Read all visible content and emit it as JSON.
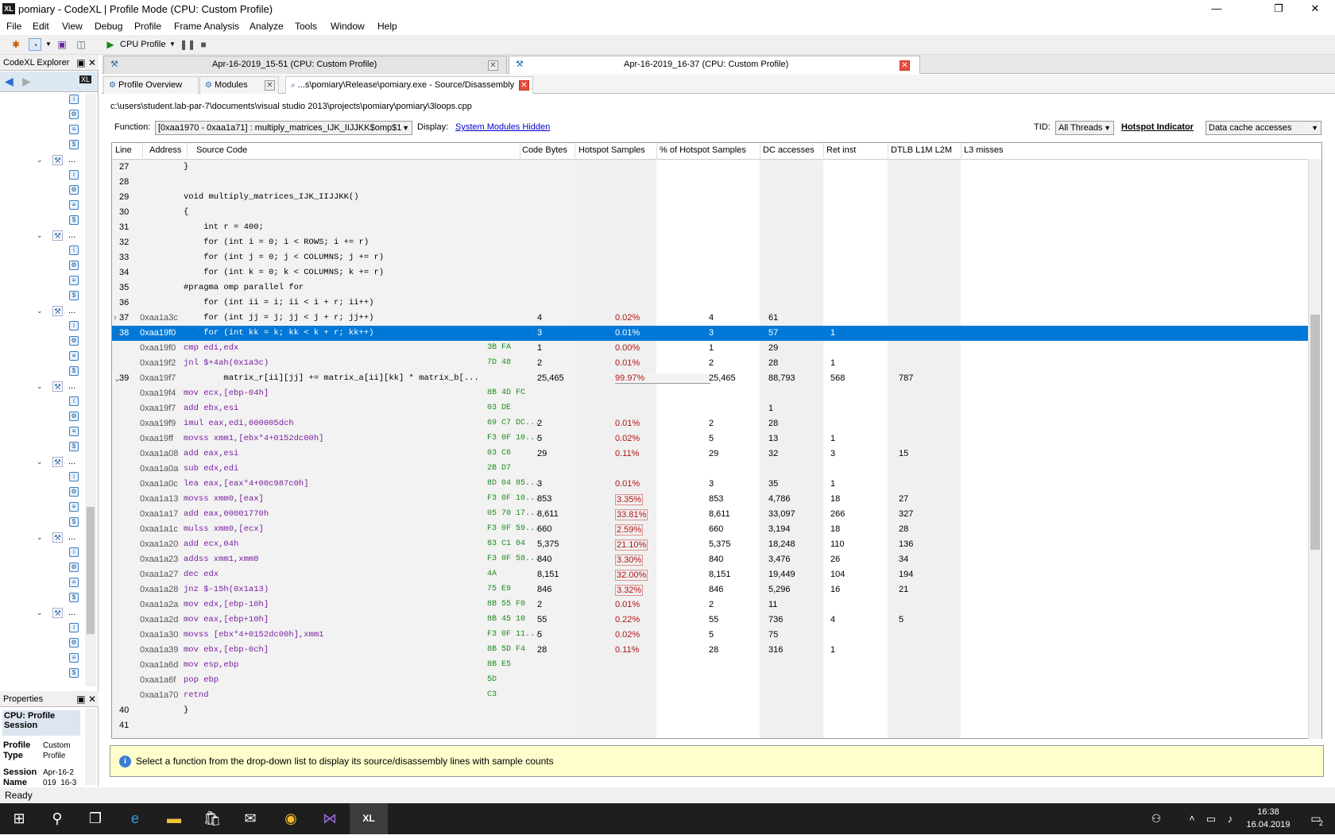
{
  "window": {
    "title": "pomiary - CodeXL | Profile Mode (CPU: Custom Profile)",
    "logo": "XL",
    "minimize": "—",
    "maximize": "❐",
    "close": "✕"
  },
  "menu": [
    "File",
    "Edit",
    "View",
    "Debug",
    "Profile",
    "Frame Analysis",
    "Analyze",
    "Tools",
    "Window",
    "Help"
  ],
  "toolbar": {
    "mode_label": "CPU Profile"
  },
  "explorer": {
    "title": "CodeXL Explorer",
    "dots": "..."
  },
  "properties": {
    "title": "Properties",
    "heading": "CPU: Profile Session",
    "rows": [
      {
        "k": "Profile Type",
        "v": "Custom Profile"
      },
      {
        "k": "Session Name",
        "v": "Apr-16-2 019_16-3"
      }
    ]
  },
  "session_tabs": [
    {
      "label": "Apr-16-2019_15-51 (CPU: Custom Profile)"
    },
    {
      "label": "Apr-16-2019_16-37 (CPU: Custom Profile)"
    }
  ],
  "sub_tabs": [
    {
      "label": "Profile Overview"
    },
    {
      "label": "Modules"
    },
    {
      "label": "...s\\pomiary\\Release\\pomiary.exe - Source/Disassembly"
    }
  ],
  "file_path": "c:\\users\\student.lab-par-7\\documents\\visual studio 2013\\projects\\pomiary\\pomiary\\3loops.cpp",
  "filter": {
    "function_label": "Function:",
    "function_value": "[0xaa1970 - 0xaa1a71] : multiply_matrices_IJK_IIJJKK$omp$1",
    "display_label": "Display:",
    "display_link": "System Modules Hidden",
    "tid_label": "TID:",
    "tid_value": "All Threads",
    "hotspot_label": "Hotspot Indicator",
    "hotspot_value": "Data cache accesses"
  },
  "columns": [
    "Line",
    "Address",
    "Source Code",
    "Code Bytes",
    "Hotspot Samples",
    "% of Hotspot Samples",
    "DC accesses",
    "Ret inst",
    "DTLB L1M L2M",
    "L3 misses"
  ],
  "rows": [
    {
      "line": "27",
      "exp": "",
      "addr": "",
      "code": "}",
      "type": "src",
      "bytes": "",
      "hs": "",
      "pct": "",
      "dc": "",
      "ret": "",
      "dtlb": "",
      "l3": ""
    },
    {
      "line": "28",
      "exp": "",
      "addr": "",
      "code": "",
      "type": "src",
      "bytes": "",
      "hs": "",
      "pct": "",
      "dc": "",
      "ret": "",
      "dtlb": "",
      "l3": ""
    },
    {
      "line": "29",
      "exp": "",
      "addr": "",
      "code": "void multiply_matrices_IJK_IIJJKK()",
      "type": "src",
      "bytes": "",
      "hs": "",
      "pct": "",
      "dc": "",
      "ret": "",
      "dtlb": "",
      "l3": ""
    },
    {
      "line": "30",
      "exp": "",
      "addr": "",
      "code": "{",
      "type": "src",
      "bytes": "",
      "hs": "",
      "pct": "",
      "dc": "",
      "ret": "",
      "dtlb": "",
      "l3": ""
    },
    {
      "line": "31",
      "exp": "",
      "addr": "",
      "code": "    int r = 400;",
      "type": "src",
      "bytes": "",
      "hs": "",
      "pct": "",
      "dc": "",
      "ret": "",
      "dtlb": "",
      "l3": ""
    },
    {
      "line": "32",
      "exp": "",
      "addr": "",
      "code": "    for (int i = 0; i < ROWS; i += r)",
      "type": "src",
      "bytes": "",
      "hs": "",
      "pct": "",
      "dc": "",
      "ret": "",
      "dtlb": "",
      "l3": ""
    },
    {
      "line": "33",
      "exp": "",
      "addr": "",
      "code": "    for (int j = 0; j < COLUMNS; j += r)",
      "type": "src",
      "bytes": "",
      "hs": "",
      "pct": "",
      "dc": "",
      "ret": "",
      "dtlb": "",
      "l3": ""
    },
    {
      "line": "34",
      "exp": "",
      "addr": "",
      "code": "    for (int k = 0; k < COLUMNS; k += r)",
      "type": "src",
      "bytes": "",
      "hs": "",
      "pct": "",
      "dc": "",
      "ret": "",
      "dtlb": "",
      "l3": ""
    },
    {
      "line": "35",
      "exp": "",
      "addr": "",
      "code": "#pragma omp parallel for",
      "type": "src",
      "bytes": "",
      "hs": "",
      "pct": "",
      "dc": "",
      "ret": "",
      "dtlb": "",
      "l3": ""
    },
    {
      "line": "36",
      "exp": "",
      "addr": "",
      "code": "    for (int ii = i; ii < i + r; ii++)",
      "type": "src",
      "bytes": "",
      "hs": "",
      "pct": "",
      "dc": "",
      "ret": "",
      "dtlb": "",
      "l3": ""
    },
    {
      "line": "37",
      "exp": "›",
      "addr": "0xaa1a3c",
      "code": "    for (int jj = j; jj < j + r; jj++)",
      "type": "src",
      "bytes": "",
      "hs": "4",
      "pct": "0.02%",
      "dc": "4",
      "ret": "61",
      "dtlb": "",
      "l3": ""
    },
    {
      "line": "38",
      "exp": "⌄",
      "addr": "0xaa19f0",
      "code": "    for (int kk = k; kk < k + r; kk++)",
      "type": "sel",
      "bytes": "",
      "hs": "3",
      "pct": "0.01%",
      "dc": "3",
      "ret": "57",
      "dtlb": "1",
      "l3": ""
    },
    {
      "line": "",
      "exp": "",
      "addr": "0xaa19f0",
      "code": "cmp edi,edx",
      "type": "asm",
      "bytes": "3B FA",
      "hs": "1",
      "pct": "0.00%",
      "dc": "1",
      "ret": "29",
      "dtlb": "",
      "l3": ""
    },
    {
      "line": "",
      "exp": "",
      "addr": "0xaa19f2",
      "code": "jnl $+4ah(0x1a3c)",
      "type": "asm",
      "bytes": "7D 48",
      "hs": "2",
      "pct": "0.01%",
      "dc": "2",
      "ret": "28",
      "dtlb": "1",
      "l3": ""
    },
    {
      "line": "39",
      "exp": "⌄",
      "addr": "0xaa19f7",
      "code": "        matrix_r[ii][jj] += matrix_a[ii][kk] * matrix_b[...",
      "type": "src",
      "bytes": "",
      "hs": "25,465",
      "pct": "99.97%",
      "dc": "25,465",
      "ret": "88,793",
      "dtlb": "568",
      "l3": "787",
      "bigbar": true
    },
    {
      "line": "",
      "exp": "",
      "addr": "0xaa19f4",
      "code": "mov ecx,[ebp-04h]",
      "type": "asm",
      "bytes": "8B 4D FC",
      "hs": "",
      "pct": "",
      "dc": "",
      "ret": "",
      "dtlb": "",
      "l3": ""
    },
    {
      "line": "",
      "exp": "",
      "addr": "0xaa19f7",
      "code": "add ebx,esi",
      "type": "asm",
      "bytes": "03 DE",
      "hs": "",
      "pct": "",
      "dc": "",
      "ret": "1",
      "dtlb": "",
      "l3": ""
    },
    {
      "line": "",
      "exp": "",
      "addr": "0xaa19f9",
      "code": "imul eax,edi,000005dch",
      "type": "asm",
      "bytes": "69 C7 DC...",
      "hs": "2",
      "pct": "0.01%",
      "dc": "2",
      "ret": "28",
      "dtlb": "",
      "l3": ""
    },
    {
      "line": "",
      "exp": "",
      "addr": "0xaa19ff",
      "code": "movss xmm1,[ebx*4+0152dc00h]",
      "type": "asm",
      "bytes": "F3 0F 10...",
      "hs": "5",
      "pct": "0.02%",
      "dc": "5",
      "ret": "13",
      "dtlb": "1",
      "l3": ""
    },
    {
      "line": "",
      "exp": "",
      "addr": "0xaa1a08",
      "code": "add eax,esi",
      "type": "asm",
      "bytes": "03 C6",
      "hs": "29",
      "pct": "0.11%",
      "dc": "29",
      "ret": "32",
      "dtlb": "3",
      "l3": "15"
    },
    {
      "line": "",
      "exp": "",
      "addr": "0xaa1a0a",
      "code": "sub edx,edi",
      "type": "asm",
      "bytes": "2B D7",
      "hs": "",
      "pct": "",
      "dc": "",
      "ret": "",
      "dtlb": "",
      "l3": ""
    },
    {
      "line": "",
      "exp": "",
      "addr": "0xaa1a0c",
      "code": "lea eax,[eax*4+00c987c0h]",
      "type": "asm",
      "bytes": "8D 04 85...",
      "hs": "3",
      "pct": "0.01%",
      "dc": "3",
      "ret": "35",
      "dtlb": "1",
      "l3": ""
    },
    {
      "line": "",
      "exp": "",
      "addr": "0xaa1a13",
      "code": "movss xmm0,[eax]",
      "type": "asm",
      "bytes": "F3 0F 10...",
      "hs": "853",
      "pct": "3.35%",
      "dc": "853",
      "ret": "4,786",
      "dtlb": "18",
      "l3": "27",
      "bar": true
    },
    {
      "line": "",
      "exp": "",
      "addr": "0xaa1a17",
      "code": "add eax,00001770h",
      "type": "asm",
      "bytes": "05 70 17...",
      "hs": "8,611",
      "pct": "33.81%",
      "dc": "8,611",
      "ret": "33,097",
      "dtlb": "266",
      "l3": "327",
      "bar": true
    },
    {
      "line": "",
      "exp": "",
      "addr": "0xaa1a1c",
      "code": "mulss xmm0,[ecx]",
      "type": "asm",
      "bytes": "F3 0F 59...",
      "hs": "660",
      "pct": "2.59%",
      "dc": "660",
      "ret": "3,194",
      "dtlb": "18",
      "l3": "28",
      "bar": true
    },
    {
      "line": "",
      "exp": "",
      "addr": "0xaa1a20",
      "code": "add ecx,04h",
      "type": "asm",
      "bytes": "83 C1 04",
      "hs": "5,375",
      "pct": "21.10%",
      "dc": "5,375",
      "ret": "18,248",
      "dtlb": "110",
      "l3": "136",
      "bar": true
    },
    {
      "line": "",
      "exp": "",
      "addr": "0xaa1a23",
      "code": "addss xmm1,xmm0",
      "type": "asm",
      "bytes": "F3 0F 58...",
      "hs": "840",
      "pct": "3.30%",
      "dc": "840",
      "ret": "3,476",
      "dtlb": "26",
      "l3": "34",
      "bar": true
    },
    {
      "line": "",
      "exp": "",
      "addr": "0xaa1a27",
      "code": "dec edx",
      "type": "asm",
      "bytes": "4A",
      "hs": "8,151",
      "pct": "32.00%",
      "dc": "8,151",
      "ret": "19,449",
      "dtlb": "104",
      "l3": "194",
      "bar": true
    },
    {
      "line": "",
      "exp": "",
      "addr": "0xaa1a28",
      "code": "jnz $-15h(0x1a13)",
      "type": "asm",
      "bytes": "75 E9",
      "hs": "846",
      "pct": "3.32%",
      "dc": "846",
      "ret": "5,296",
      "dtlb": "16",
      "l3": "21",
      "bar": true
    },
    {
      "line": "",
      "exp": "",
      "addr": "0xaa1a2a",
      "code": "mov edx,[ebp-10h]",
      "type": "asm",
      "bytes": "8B 55 F0",
      "hs": "2",
      "pct": "0.01%",
      "dc": "2",
      "ret": "11",
      "dtlb": "",
      "l3": ""
    },
    {
      "line": "",
      "exp": "",
      "addr": "0xaa1a2d",
      "code": "mov eax,[ebp+10h]",
      "type": "asm",
      "bytes": "8B 45 10",
      "hs": "55",
      "pct": "0.22%",
      "dc": "55",
      "ret": "736",
      "dtlb": "4",
      "l3": "5"
    },
    {
      "line": "",
      "exp": "",
      "addr": "0xaa1a30",
      "code": "movss [ebx*4+0152dc00h],xmm1",
      "type": "asm",
      "bytes": "F3 0F 11...",
      "hs": "5",
      "pct": "0.02%",
      "dc": "5",
      "ret": "75",
      "dtlb": "",
      "l3": ""
    },
    {
      "line": "",
      "exp": "",
      "addr": "0xaa1a39",
      "code": "mov ebx,[ebp-0ch]",
      "type": "asm",
      "bytes": "8B 5D F4",
      "hs": "28",
      "pct": "0.11%",
      "dc": "28",
      "ret": "316",
      "dtlb": "1",
      "l3": ""
    },
    {
      "line": "",
      "exp": "",
      "addr": "0xaa1a6d",
      "code": "mov esp,ebp",
      "type": "asm",
      "bytes": "8B E5",
      "hs": "",
      "pct": "",
      "dc": "",
      "ret": "",
      "dtlb": "",
      "l3": ""
    },
    {
      "line": "",
      "exp": "",
      "addr": "0xaa1a6f",
      "code": "pop ebp",
      "type": "asm",
      "bytes": "5D",
      "hs": "",
      "pct": "",
      "dc": "",
      "ret": "",
      "dtlb": "",
      "l3": ""
    },
    {
      "line": "",
      "exp": "",
      "addr": "0xaa1a70",
      "code": "retnd",
      "type": "asm",
      "bytes": "C3",
      "hs": "",
      "pct": "",
      "dc": "",
      "ret": "",
      "dtlb": "",
      "l3": ""
    },
    {
      "line": "40",
      "exp": "",
      "addr": "",
      "code": "}",
      "type": "src",
      "bytes": "",
      "hs": "",
      "pct": "",
      "dc": "",
      "ret": "",
      "dtlb": "",
      "l3": ""
    },
    {
      "line": "41",
      "exp": "",
      "addr": "",
      "code": "",
      "type": "src",
      "bytes": "",
      "hs": "",
      "pct": "",
      "dc": "",
      "ret": "",
      "dtlb": "",
      "l3": ""
    }
  ],
  "info_message": "Select a function from the drop-down list to display its source/disassembly lines with sample counts",
  "status": "Ready",
  "clock": {
    "time": "16:38",
    "date": "16.04.2019"
  },
  "taskbar": {
    "notification_count": "2"
  }
}
